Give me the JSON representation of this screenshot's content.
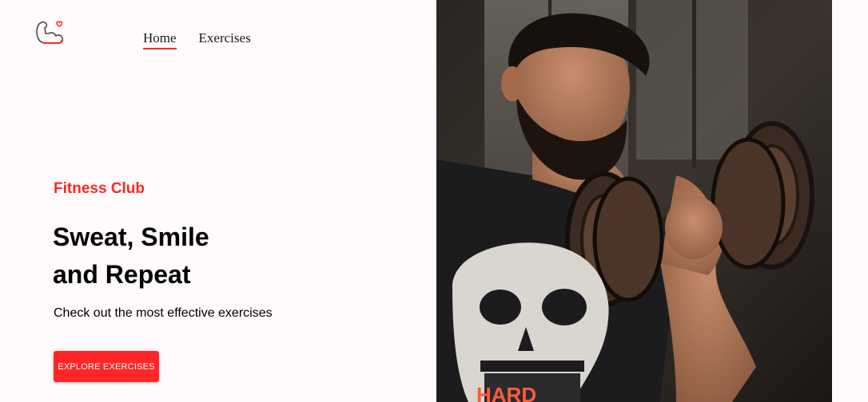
{
  "nav": {
    "items": [
      {
        "label": "Home",
        "active": true
      },
      {
        "label": "Exercises",
        "active": false
      }
    ]
  },
  "hero": {
    "eyebrow": "Fitness Club",
    "headline_line1": "Sweat, Smile",
    "headline_line2": "and Repeat",
    "subtext": "Check out the most effective exercises",
    "cta_label": "EXPLORE EXERCISES",
    "image_shirt_text": "HARD"
  },
  "colors": {
    "accent": "#ff2625",
    "background": "#fffafb"
  },
  "icons": {
    "logo": "flexed-arm-heart-icon"
  }
}
